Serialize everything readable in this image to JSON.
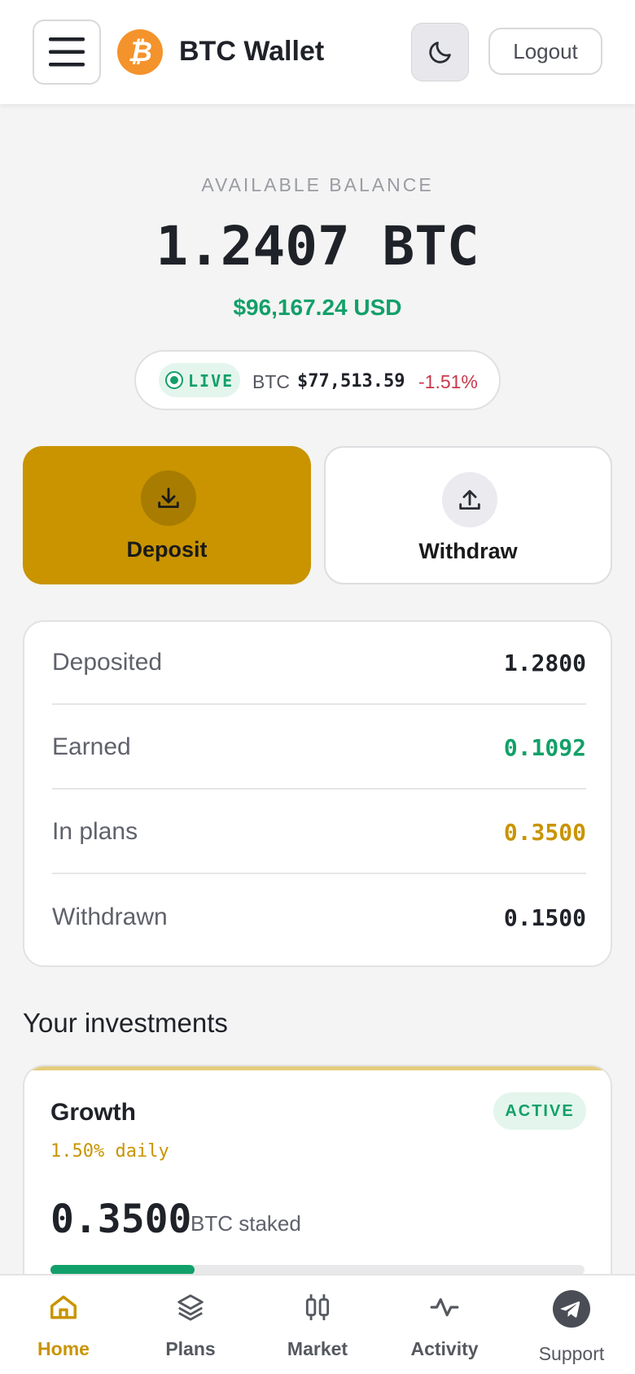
{
  "header": {
    "logo_glyph": "₿",
    "title": "BTC Wallet",
    "logout_label": "Logout",
    "icons": [
      "hamburger-menu-icon",
      "bitcoin-icon",
      "moon-icon"
    ]
  },
  "balance": {
    "label": "AVAILABLE BALANCE",
    "btc": "1.2407 BTC",
    "usd": "$96,167.24 USD"
  },
  "ticker": {
    "live_label": "LIVE",
    "symbol": "BTC",
    "price": "$77,513.59",
    "change": "-1.51%"
  },
  "actions": {
    "deposit_label": "Deposit",
    "withdraw_label": "Withdraw"
  },
  "stats": [
    {
      "label": "Deposited",
      "value": "1.2800",
      "color": "#1f2228"
    },
    {
      "label": "Earned",
      "value": "0.1092",
      "color": "#12a06a"
    },
    {
      "label": "In plans",
      "value": "0.3500",
      "color": "#c99400"
    },
    {
      "label": "Withdrawn",
      "value": "0.1500",
      "color": "#1f2228"
    }
  ],
  "investments": {
    "title": "Your investments",
    "items": [
      {
        "name": "Growth",
        "status": "ACTIVE",
        "rate": "1.50% daily",
        "amount": "0.3500",
        "unit": "BTC staked",
        "progress": 0.27
      }
    ]
  },
  "nav": [
    {
      "label": "Home",
      "icon": "home-icon",
      "active": true
    },
    {
      "label": "Plans",
      "icon": "layers-icon",
      "active": false
    },
    {
      "label": "Market",
      "icon": "candlestick-icon",
      "active": false
    },
    {
      "label": "Activity",
      "icon": "activity-pulse-icon",
      "active": false
    },
    {
      "label": "Support",
      "icon": "telegram-icon",
      "active": false
    }
  ],
  "colors": {
    "accent": "#c99400",
    "positive": "#12a06a",
    "negative": "#c9394c"
  }
}
